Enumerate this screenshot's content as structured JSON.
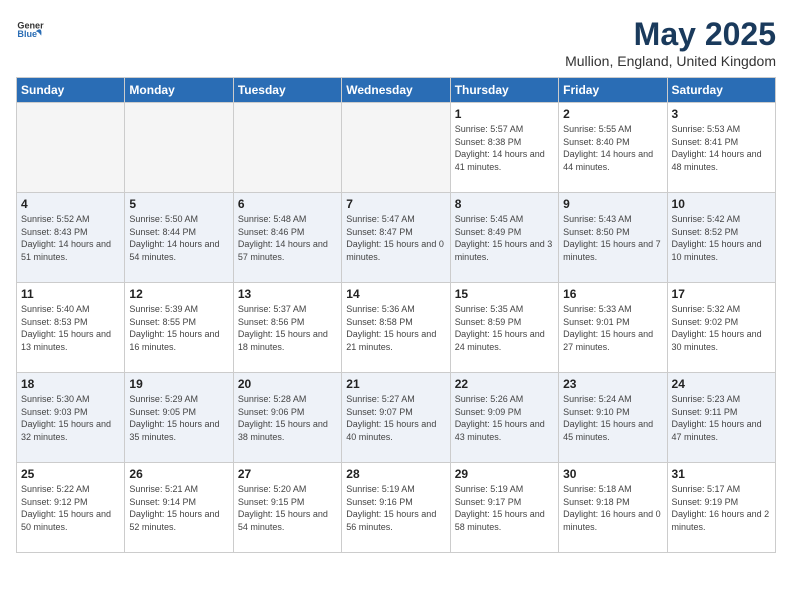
{
  "header": {
    "logo_general": "General",
    "logo_blue": "Blue",
    "title": "May 2025",
    "location": "Mullion, England, United Kingdom"
  },
  "weekdays": [
    "Sunday",
    "Monday",
    "Tuesday",
    "Wednesday",
    "Thursday",
    "Friday",
    "Saturday"
  ],
  "weeks": [
    [
      {
        "day": "",
        "empty": true
      },
      {
        "day": "",
        "empty": true
      },
      {
        "day": "",
        "empty": true
      },
      {
        "day": "",
        "empty": true
      },
      {
        "day": "1",
        "sunrise": "5:57 AM",
        "sunset": "8:38 PM",
        "daylight": "14 hours and 41 minutes."
      },
      {
        "day": "2",
        "sunrise": "5:55 AM",
        "sunset": "8:40 PM",
        "daylight": "14 hours and 44 minutes."
      },
      {
        "day": "3",
        "sunrise": "5:53 AM",
        "sunset": "8:41 PM",
        "daylight": "14 hours and 48 minutes."
      }
    ],
    [
      {
        "day": "4",
        "sunrise": "5:52 AM",
        "sunset": "8:43 PM",
        "daylight": "14 hours and 51 minutes."
      },
      {
        "day": "5",
        "sunrise": "5:50 AM",
        "sunset": "8:44 PM",
        "daylight": "14 hours and 54 minutes."
      },
      {
        "day": "6",
        "sunrise": "5:48 AM",
        "sunset": "8:46 PM",
        "daylight": "14 hours and 57 minutes."
      },
      {
        "day": "7",
        "sunrise": "5:47 AM",
        "sunset": "8:47 PM",
        "daylight": "15 hours and 0 minutes."
      },
      {
        "day": "8",
        "sunrise": "5:45 AM",
        "sunset": "8:49 PM",
        "daylight": "15 hours and 3 minutes."
      },
      {
        "day": "9",
        "sunrise": "5:43 AM",
        "sunset": "8:50 PM",
        "daylight": "15 hours and 7 minutes."
      },
      {
        "day": "10",
        "sunrise": "5:42 AM",
        "sunset": "8:52 PM",
        "daylight": "15 hours and 10 minutes."
      }
    ],
    [
      {
        "day": "11",
        "sunrise": "5:40 AM",
        "sunset": "8:53 PM",
        "daylight": "15 hours and 13 minutes."
      },
      {
        "day": "12",
        "sunrise": "5:39 AM",
        "sunset": "8:55 PM",
        "daylight": "15 hours and 16 minutes."
      },
      {
        "day": "13",
        "sunrise": "5:37 AM",
        "sunset": "8:56 PM",
        "daylight": "15 hours and 18 minutes."
      },
      {
        "day": "14",
        "sunrise": "5:36 AM",
        "sunset": "8:58 PM",
        "daylight": "15 hours and 21 minutes."
      },
      {
        "day": "15",
        "sunrise": "5:35 AM",
        "sunset": "8:59 PM",
        "daylight": "15 hours and 24 minutes."
      },
      {
        "day": "16",
        "sunrise": "5:33 AM",
        "sunset": "9:01 PM",
        "daylight": "15 hours and 27 minutes."
      },
      {
        "day": "17",
        "sunrise": "5:32 AM",
        "sunset": "9:02 PM",
        "daylight": "15 hours and 30 minutes."
      }
    ],
    [
      {
        "day": "18",
        "sunrise": "5:30 AM",
        "sunset": "9:03 PM",
        "daylight": "15 hours and 32 minutes."
      },
      {
        "day": "19",
        "sunrise": "5:29 AM",
        "sunset": "9:05 PM",
        "daylight": "15 hours and 35 minutes."
      },
      {
        "day": "20",
        "sunrise": "5:28 AM",
        "sunset": "9:06 PM",
        "daylight": "15 hours and 38 minutes."
      },
      {
        "day": "21",
        "sunrise": "5:27 AM",
        "sunset": "9:07 PM",
        "daylight": "15 hours and 40 minutes."
      },
      {
        "day": "22",
        "sunrise": "5:26 AM",
        "sunset": "9:09 PM",
        "daylight": "15 hours and 43 minutes."
      },
      {
        "day": "23",
        "sunrise": "5:24 AM",
        "sunset": "9:10 PM",
        "daylight": "15 hours and 45 minutes."
      },
      {
        "day": "24",
        "sunrise": "5:23 AM",
        "sunset": "9:11 PM",
        "daylight": "15 hours and 47 minutes."
      }
    ],
    [
      {
        "day": "25",
        "sunrise": "5:22 AM",
        "sunset": "9:12 PM",
        "daylight": "15 hours and 50 minutes."
      },
      {
        "day": "26",
        "sunrise": "5:21 AM",
        "sunset": "9:14 PM",
        "daylight": "15 hours and 52 minutes."
      },
      {
        "day": "27",
        "sunrise": "5:20 AM",
        "sunset": "9:15 PM",
        "daylight": "15 hours and 54 minutes."
      },
      {
        "day": "28",
        "sunrise": "5:19 AM",
        "sunset": "9:16 PM",
        "daylight": "15 hours and 56 minutes."
      },
      {
        "day": "29",
        "sunrise": "5:19 AM",
        "sunset": "9:17 PM",
        "daylight": "15 hours and 58 minutes."
      },
      {
        "day": "30",
        "sunrise": "5:18 AM",
        "sunset": "9:18 PM",
        "daylight": "16 hours and 0 minutes."
      },
      {
        "day": "31",
        "sunrise": "5:17 AM",
        "sunset": "9:19 PM",
        "daylight": "16 hours and 2 minutes."
      }
    ]
  ]
}
